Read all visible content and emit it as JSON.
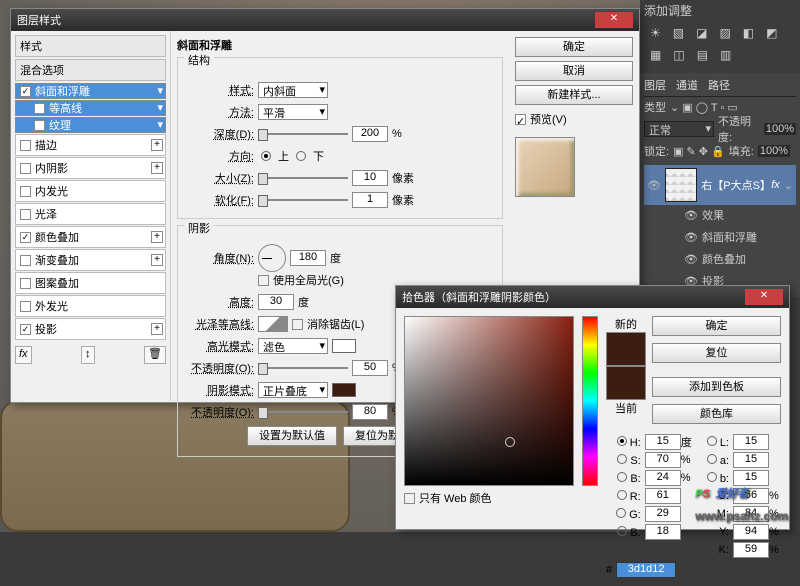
{
  "layerStyle": {
    "title": "图层样式",
    "stylesHeader": "样式",
    "blendHeader": "混合选项",
    "items": [
      {
        "label": "斜面和浮雕",
        "checked": true,
        "sel": true,
        "plus": false
      },
      {
        "label": "等高线",
        "checked": false,
        "sel": true,
        "plus": false,
        "indent": true
      },
      {
        "label": "纹理",
        "checked": false,
        "sel": true,
        "plus": false,
        "indent": true
      },
      {
        "label": "描边",
        "checked": false,
        "plus": true
      },
      {
        "label": "内阴影",
        "checked": false,
        "plus": true
      },
      {
        "label": "内发光",
        "checked": false,
        "plus": false
      },
      {
        "label": "光泽",
        "checked": false,
        "plus": false
      },
      {
        "label": "颜色叠加",
        "checked": true,
        "plus": true
      },
      {
        "label": "渐变叠加",
        "checked": false,
        "plus": true
      },
      {
        "label": "图案叠加",
        "checked": false,
        "plus": false
      },
      {
        "label": "外发光",
        "checked": false,
        "plus": false
      },
      {
        "label": "投影",
        "checked": true,
        "plus": true
      }
    ],
    "fx": "fx",
    "sectionTitle": "斜面和浮雕",
    "struct": "结构",
    "styleLbl": "样式:",
    "styleVal": "内斜面",
    "methodLbl": "方法:",
    "methodVal": "平滑",
    "depthLbl": "深度(D):",
    "depthVal": "200",
    "pct": "%",
    "dirLbl": "方向:",
    "up": "上",
    "down": "下",
    "sizeLbl": "大小(Z):",
    "sizeVal": "10",
    "px": "像素",
    "softLbl": "软化(F):",
    "softVal": "1",
    "shadow": "阴影",
    "angleLbl": "角度(N):",
    "angleVal": "180",
    "deg": "度",
    "globalLight": "使用全局光(G)",
    "altLbl": "高度:",
    "altVal": "30",
    "glossLbl": "光泽等高线:",
    "antialias": "消除锯齿(L)",
    "hlModeLbl": "高光模式:",
    "hlModeVal": "滤色",
    "opLbl": "不透明度(O):",
    "op1": "50",
    "shModeLbl": "阴影模式:",
    "shModeVal": "正片叠底",
    "op2": "80",
    "defaultBtn": "设置为默认值",
    "resetBtn": "复位为默认值",
    "ok": "确定",
    "cancel": "取消",
    "newStyle": "新建样式...",
    "preview": "预览(V)"
  },
  "picker": {
    "title": "拾色器（斜面和浮雕阴影颜色）",
    "new": "新的",
    "current": "当前",
    "ok": "确定",
    "cancel": "复位",
    "addSwatch": "添加到色板",
    "colorLib": "颜色库",
    "H": "H:",
    "Hval": "15",
    "Hdeg": "度",
    "S": "S:",
    "Sval": "70",
    "Spct": "%",
    "B": "B:",
    "Bval": "24",
    "Bpct": "%",
    "L": "L:",
    "Lval": "15",
    "a": "a:",
    "aval": "15",
    "b": "b:",
    "bval": "15",
    "R": "R:",
    "Rval": "61",
    "C": "C:",
    "Cval": "66",
    "Cpct": "%",
    "G": "G:",
    "Gval": "29",
    "M": "M:",
    "Mval": "84",
    "Mpct": "%",
    "Bb": "B:",
    "Bbval": "18",
    "Y": "Y:",
    "Yval": "94",
    "Ypct": "%",
    "K": "K:",
    "Kval": "59",
    "Kpct": "%",
    "webOnly": "只有 Web 颜色",
    "hexLbl": "#",
    "hex": "3d1d12"
  },
  "rpanel": {
    "adjustments": "添加调整",
    "layersTab": "图层",
    "channels": "通道",
    "paths": "路径",
    "kind": "类型",
    "opacity": "不透明度:",
    "opVal": "100%",
    "normal": "正常",
    "lock": "锁定:",
    "fill": "填充:",
    "fillVal": "100%",
    "layerName": "右【P大点S】",
    "fx": "fx",
    "effects": "效果",
    "bevel": "斜面和浮雕",
    "colorOverlay": "颜色叠加",
    "dropShadow": "投影"
  },
  "watermark": {
    "p": "P",
    "s": "S",
    "txt": "爱好者",
    "url": "www.psahz.com"
  }
}
